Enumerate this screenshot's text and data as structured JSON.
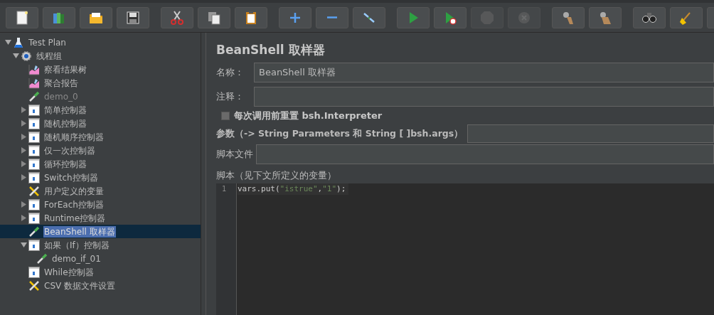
{
  "toolbar": [
    {
      "buttons": [
        {
          "kind": "new",
          "disabled": false
        },
        {
          "kind": "templates",
          "disabled": false
        },
        {
          "kind": "open",
          "disabled": false
        },
        {
          "kind": "save",
          "disabled": false
        }
      ]
    },
    {
      "buttons": [
        {
          "kind": "cut",
          "disabled": false
        },
        {
          "kind": "copy",
          "disabled": false
        },
        {
          "kind": "paste",
          "disabled": false
        }
      ]
    },
    {
      "buttons": [
        {
          "kind": "expand",
          "disabled": false
        },
        {
          "kind": "collapse",
          "disabled": false
        },
        {
          "kind": "toggle",
          "disabled": false
        }
      ]
    },
    {
      "buttons": [
        {
          "kind": "start",
          "disabled": false
        },
        {
          "kind": "start-no-pause",
          "disabled": false
        },
        {
          "kind": "stop",
          "disabled": true
        },
        {
          "kind": "shutdown",
          "disabled": true
        }
      ]
    },
    {
      "buttons": [
        {
          "kind": "clear",
          "disabled": false
        },
        {
          "kind": "clear-all",
          "disabled": false
        }
      ]
    },
    {
      "buttons": [
        {
          "kind": "search",
          "disabled": false
        },
        {
          "kind": "reset-search",
          "disabled": false
        },
        {
          "kind": "cut-off"
        }
      ]
    }
  ],
  "tree": [
    {
      "label": "Test Plan",
      "kind": "plan",
      "selected": false,
      "disabled": false,
      "expanded": true,
      "children": [
        {
          "label": "线程组",
          "kind": "threadgroup",
          "selected": false,
          "disabled": false,
          "expanded": true,
          "children": [
            {
              "label": "察看结果树",
              "kind": "listener",
              "selected": false,
              "disabled": false
            },
            {
              "label": "聚合报告",
              "kind": "listener",
              "selected": false,
              "disabled": false
            },
            {
              "label": "demo_0",
              "kind": "sampler",
              "selected": false,
              "disabled": true
            },
            {
              "label": "简单控制器",
              "kind": "controller",
              "selected": false,
              "disabled": false,
              "expanded": false
            },
            {
              "label": "随机控制器",
              "kind": "controller",
              "selected": false,
              "disabled": false,
              "expanded": false
            },
            {
              "label": "随机顺序控制器",
              "kind": "controller",
              "selected": false,
              "disabled": false,
              "expanded": false
            },
            {
              "label": "仅一次控制器",
              "kind": "controller",
              "selected": false,
              "disabled": false,
              "expanded": false
            },
            {
              "label": "循环控制器",
              "kind": "controller",
              "selected": false,
              "disabled": false,
              "expanded": false
            },
            {
              "label": "Switch控制器",
              "kind": "controller",
              "selected": false,
              "disabled": false,
              "expanded": false
            },
            {
              "label": "用户定义的变量",
              "kind": "config",
              "selected": false,
              "disabled": false
            },
            {
              "label": "ForEach控制器",
              "kind": "controller",
              "selected": false,
              "disabled": false,
              "expanded": false
            },
            {
              "label": "Runtime控制器",
              "kind": "controller",
              "selected": false,
              "disabled": false,
              "expanded": false
            },
            {
              "label": "BeanShell 取样器",
              "kind": "sampler",
              "selected": true,
              "disabled": false
            },
            {
              "label": "如果（If）控制器",
              "kind": "controller",
              "selected": false,
              "disabled": false,
              "expanded": true,
              "children": [
                {
                  "label": "demo_if_01",
                  "kind": "sampler",
                  "selected": false,
                  "disabled": false
                }
              ]
            },
            {
              "label": "While控制器",
              "kind": "controller",
              "selected": false,
              "disabled": false
            },
            {
              "label": "CSV 数据文件设置",
              "kind": "config",
              "selected": false,
              "disabled": false
            }
          ]
        }
      ]
    }
  ],
  "panel": {
    "title": "BeanShell 取样器",
    "name_label": "名称：",
    "name_value": "BeanShell 取样器",
    "comment_label": "注释：",
    "reset": {
      "label": "每次调用前重置 bsh.Interpreter",
      "checked": false
    },
    "params_label": "参数（-> String Parameters 和 String [ ]bsh.args）",
    "file_label": "脚本文件",
    "script_label": "脚本（见下文所定义的变量）",
    "script_lines": [
      {
        "number": "1",
        "tokens": [
          {
            "text": "vars.put(",
            "kind": "plain"
          },
          {
            "text": "\"istrue\"",
            "kind": "string"
          },
          {
            "text": ",",
            "kind": "plain"
          },
          {
            "text": "\"1\"",
            "kind": "string"
          },
          {
            "text": ");",
            "kind": "plain"
          }
        ]
      }
    ]
  }
}
